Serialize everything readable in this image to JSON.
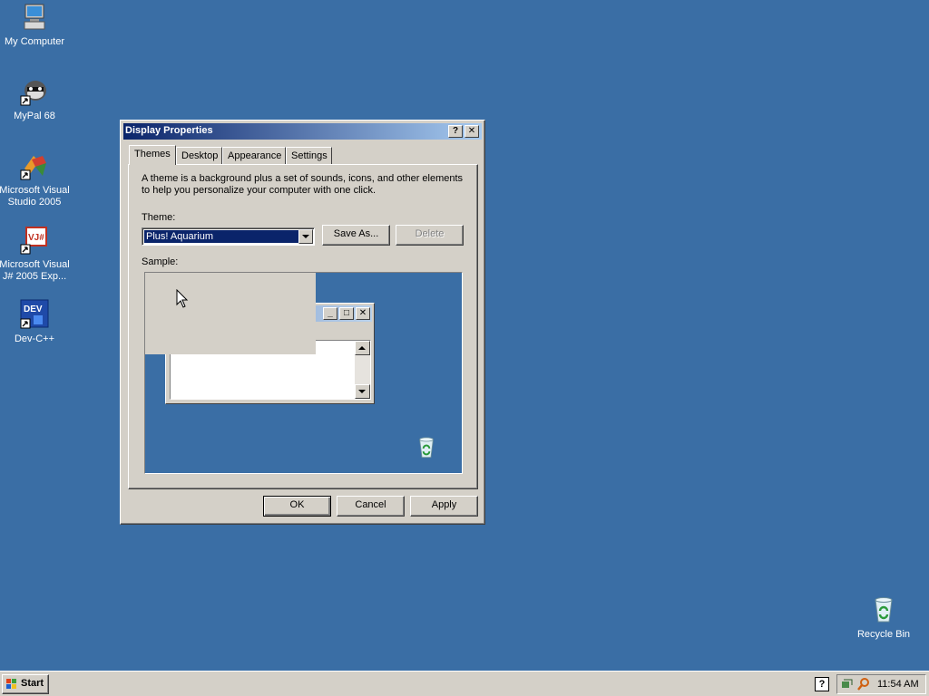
{
  "desktop": {
    "icons": [
      {
        "label": "My Computer",
        "icon": "computer-icon"
      },
      {
        "label": "MyPal 68",
        "icon": "raccoon-icon"
      },
      {
        "label": "Microsoft Visual Studio 2005",
        "icon": "visual-studio-icon"
      },
      {
        "label": "Microsoft Visual J# 2005 Exp...",
        "icon": "visual-jsharp-icon"
      },
      {
        "label": "Dev-C++",
        "icon": "devcpp-icon"
      },
      {
        "label": "Recycle Bin",
        "icon": "recycle-bin-icon"
      }
    ]
  },
  "dialog": {
    "title": "Display Properties",
    "help_button": "?",
    "close_button": "✕",
    "tabs": [
      "Themes",
      "Desktop",
      "Appearance",
      "Settings"
    ],
    "active_tab": "Themes",
    "description": "A theme is a background plus a set of sounds, icons, and other elements to help you personalize your computer with one click.",
    "theme_label": "Theme:",
    "theme_value": "Plus! Aquarium",
    "save_as_label": "Save As...",
    "delete_label": "Delete",
    "sample_label": "Sample:",
    "ok_label": "OK",
    "cancel_label": "Cancel",
    "apply_label": "Apply"
  },
  "taskbar": {
    "start_label": "Start",
    "clock": "11:54 AM"
  },
  "colors": {
    "desktop": "#3a6ea5",
    "title_active": "#0a246a",
    "face": "#d4d0c8"
  }
}
